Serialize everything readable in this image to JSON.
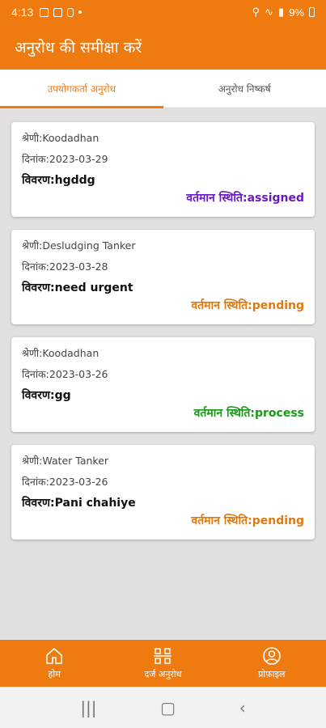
{
  "status_bar": {
    "time": "4:13",
    "battery": "9%"
  },
  "app_bar": {
    "title": "अनुरोध की समीक्षा करें"
  },
  "tabs": [
    {
      "label": "उपयोगकर्ता अनुरोध",
      "active": true
    },
    {
      "label": "अनुरोध निष्कर्ष",
      "active": false
    }
  ],
  "requests": [
    {
      "category": "श्रेणी:Koodadhan",
      "date": "दिनांक:2023-03-29",
      "description": "विवरण:hgddg",
      "status": "वर्तमान स्थिति:assigned",
      "status_color": "#6a1bbf"
    },
    {
      "category": "श्रेणी:Desludging Tanker",
      "date": "दिनांक:2023-03-28",
      "description": "विवरण:need urgent",
      "status": "वर्तमान स्थिति:pending",
      "status_color": "#e07a10"
    },
    {
      "category": "श्रेणी:Koodadhan",
      "date": "दिनांक:2023-03-26",
      "description": "विवरण:gg",
      "status": "वर्तमान स्थिति:process",
      "status_color": "#1a9a1a"
    },
    {
      "category": "श्रेणी:Water Tanker",
      "date": "दिनांक:2023-03-26",
      "description": "विवरण:Pani chahiye",
      "status": "वर्तमान स्थिति:pending",
      "status_color": "#e07a10"
    }
  ],
  "bottom_nav": [
    {
      "label": "होम",
      "icon": "home-icon"
    },
    {
      "label": "दर्ज अनुरोध",
      "icon": "qr-scan-icon"
    },
    {
      "label": "प्रोफ़ाइल",
      "icon": "profile-icon"
    }
  ],
  "colors": {
    "accent": "#ef7a10"
  }
}
